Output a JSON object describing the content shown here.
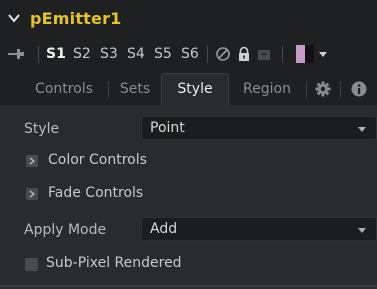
{
  "node": {
    "title": "pEmitter1",
    "slots": [
      "S1",
      "S2",
      "S3",
      "S4",
      "S5",
      "S6"
    ],
    "active_slot": "S1"
  },
  "tabs": {
    "controls": "Controls",
    "sets": "Sets",
    "style": "Style",
    "region": "Region",
    "active": "Style"
  },
  "style_tab": {
    "style_label": "Style",
    "style_value": "Point",
    "color_controls_label": "Color Controls",
    "fade_controls_label": "Fade Controls",
    "apply_mode_label": "Apply Mode",
    "apply_mode_value": "Add",
    "subpixel_label": "Sub-Pixel Rendered",
    "subpixel_checked": false
  },
  "icons": {
    "collapse": "chevron-down-icon",
    "pin": "pin-icon",
    "disable": "disable-icon",
    "lock": "lock-icon",
    "reset": "reset-icon",
    "settings": "gear-icon",
    "info": "info-icon"
  },
  "colors": {
    "title": "#e3c52a",
    "swatch_primary": "#c79bc6",
    "swatch_secondary": "#111111"
  }
}
